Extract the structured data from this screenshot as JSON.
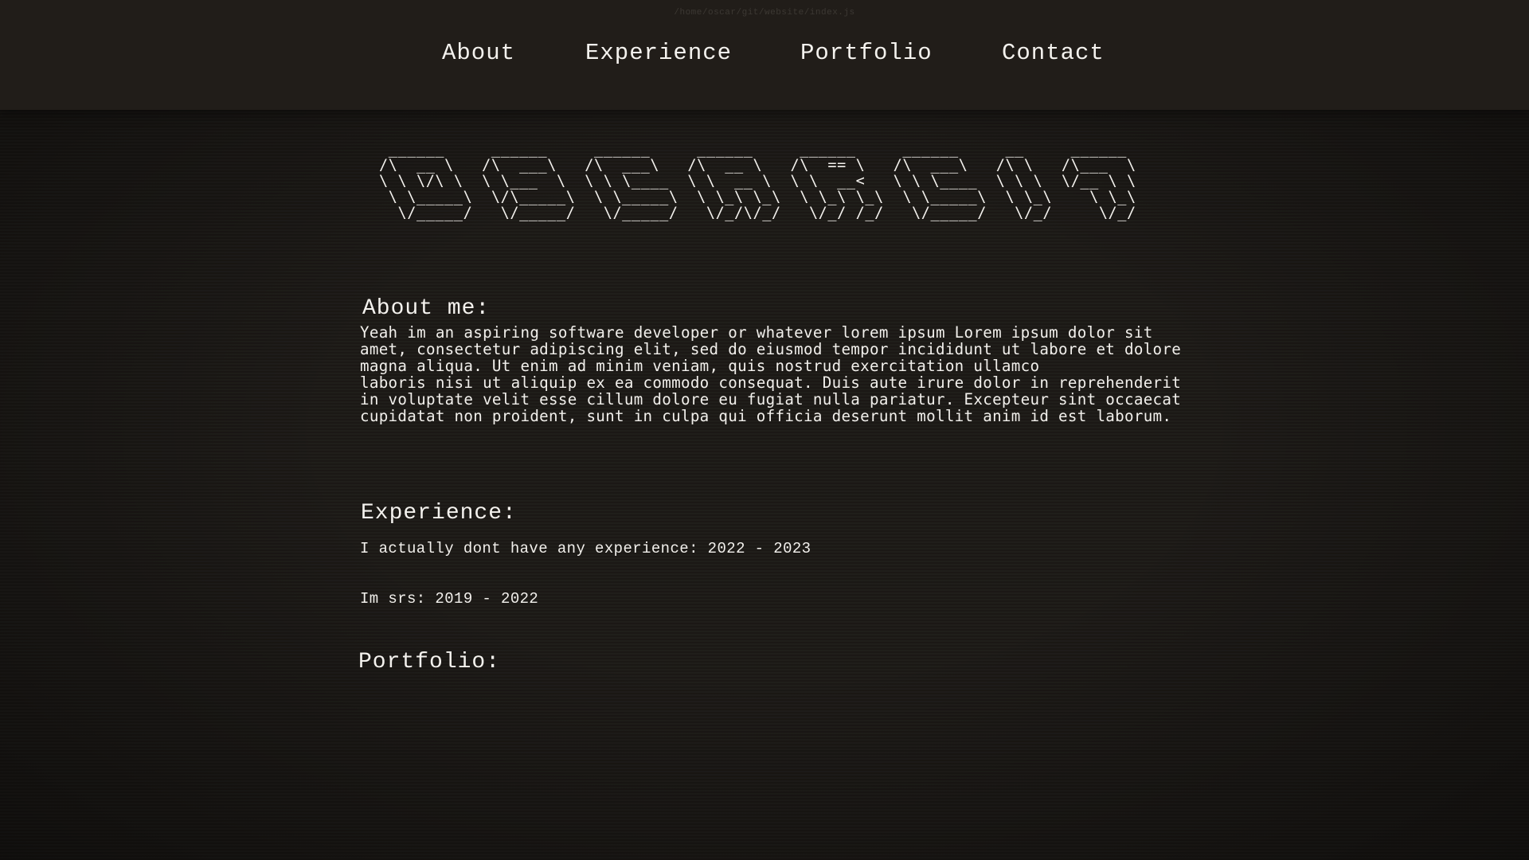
{
  "file_path_hint": "/home/oscar/git/website/index.js",
  "nav": {
    "about": "About",
    "experience": "Experience",
    "portfolio": "Portfolio",
    "contact": "Contact"
  },
  "banner_ascii": " ______     ______     ______     ______     ______     ______     __     ______  \n/\\  __ \\   /\\  ___\\   /\\  ___\\   /\\  __ \\   /\\  == \\   /\\  ___\\   /\\ \\   /\\___  \\ \n\\ \\ \\/\\ \\  \\ \\___  \\  \\ \\ \\____  \\ \\  __ \\  \\ \\  __<   \\ \\ \\____  \\ \\ \\  \\/__ \\ \\ \n \\ \\_____\\  \\/\\_____\\  \\ \\_____\\  \\ \\_\\ \\_\\  \\ \\_\\ \\_\\  \\ \\_____\\  \\ \\_\\    \\ \\_\\\n  \\/_____/   \\/_____/   \\/_____/   \\/_/\\/_/   \\/_/ /_/   \\/_____/   \\/_/     \\/_/",
  "about": {
    "title": "About me:",
    "text": "Yeah im an aspiring software developer or whatever lorem ipsum Lorem ipsum dolor sit\namet, consectetur adipiscing elit, sed do eiusmod tempor incididunt ut labore et dolore\nmagna aliqua. Ut enim ad minim veniam, quis nostrud exercitation ullamco\nlaboris nisi ut aliquip ex ea commodo consequat. Duis aute irure dolor in reprehenderit\nin voluptate velit esse cillum dolore eu fugiat nulla pariatur. Excepteur sint occaecat\ncupidatat non proident, sunt in culpa qui officia deserunt mollit anim id est laborum."
  },
  "experience": {
    "title": "Experience:",
    "items": [
      "I actually dont have any experience: 2022 - 2023",
      "Im srs: 2019 - 2022"
    ]
  },
  "portfolio": {
    "title": "Portfolio:"
  }
}
